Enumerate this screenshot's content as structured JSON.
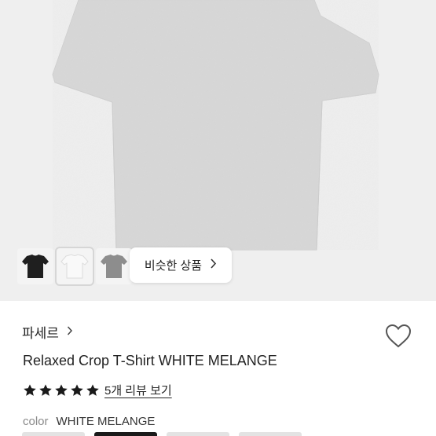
{
  "gallery": {
    "thumbnails": [
      {
        "name": "black-tshirt",
        "color": "#1f1f1f"
      },
      {
        "name": "white-tshirt",
        "color": "#f6f6f6"
      },
      {
        "name": "gray-tshirt",
        "color": "#8d8d8d"
      }
    ],
    "similar_label": "비슷한 상품",
    "similar_icon": "chevron-right-icon"
  },
  "product": {
    "brand": "파세르",
    "brand_icon": "chevron-right-icon",
    "title": "Relaxed Crop T-Shirt WHITE MELANGE",
    "rating": 5,
    "review_link": "5개 리뷰 보기",
    "color_label": "color",
    "color_value": "WHITE MELANGE",
    "wishlist_icon": "heart-outline-icon"
  },
  "colors": {
    "hero_bg": "#efefef",
    "shirt": "#d9d9d9",
    "star": "#1a1a1a"
  }
}
